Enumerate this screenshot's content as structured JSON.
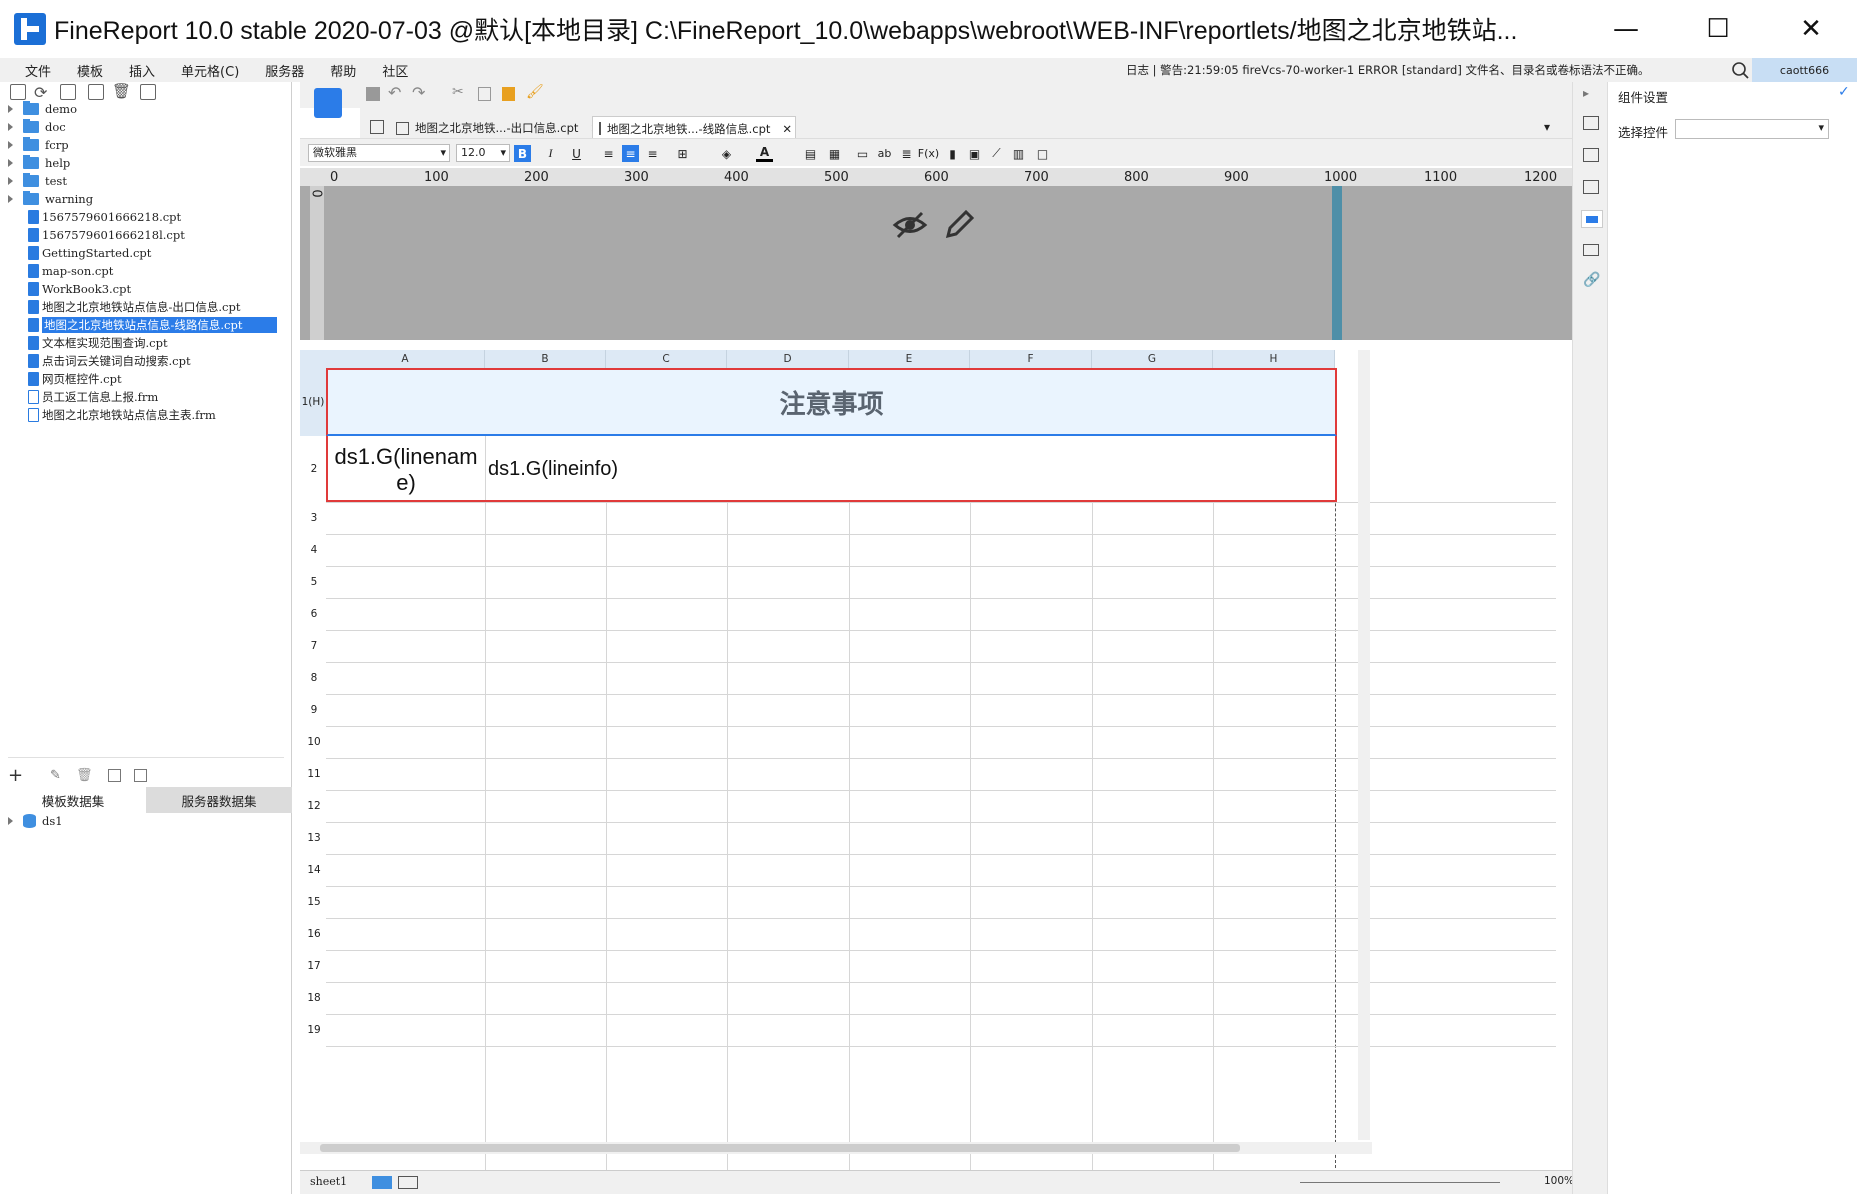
{
  "window": {
    "title": "FineReport 10.0 stable 2020-07-03 @默认[本地目录]    C:\\FineReport_10.0\\webapps\\webroot\\WEB-INF\\reportlets/地图之北京地铁站...",
    "minimize": "—",
    "maximize": "☐",
    "close": "✕"
  },
  "menubar": {
    "items": [
      "文件",
      "模板",
      "插入",
      "单元格(C)",
      "服务器",
      "帮助",
      "社区"
    ],
    "log": "日志 | 警告:21:59:05 fireVcs-70-worker-1 ERROR [standard] 文件名、目录名或卷标语法不正确。",
    "user": "caott666"
  },
  "file_tree": {
    "folders": [
      "demo",
      "doc",
      "fcrp",
      "help",
      "test",
      "warning"
    ],
    "files": [
      {
        "name": "1567579601666218.cpt",
        "type": "cpt"
      },
      {
        "name": "1567579601666218l.cpt",
        "type": "cpt"
      },
      {
        "name": "GettingStarted.cpt",
        "type": "cpt"
      },
      {
        "name": "map-son.cpt",
        "type": "cpt"
      },
      {
        "name": "WorkBook3.cpt",
        "type": "cpt"
      },
      {
        "name": "地图之北京地铁站点信息-出口信息.cpt",
        "type": "cpt"
      },
      {
        "name": "地图之北京地铁站点信息-线路信息.cpt",
        "type": "cpt",
        "selected": true
      },
      {
        "name": "文本框实现范围查询.cpt",
        "type": "cpt"
      },
      {
        "name": "点击词云关键词自动搜索.cpt",
        "type": "cpt"
      },
      {
        "name": "网页框控件.cpt",
        "type": "cpt"
      },
      {
        "name": "员工返工信息上报.frm",
        "type": "frm"
      },
      {
        "name": "地图之北京地铁站点信息主表.frm",
        "type": "frm"
      }
    ]
  },
  "datasets": {
    "tabs": [
      "模板数据集",
      "服务器数据集"
    ],
    "items": [
      "ds1"
    ]
  },
  "doc_tabs": [
    {
      "label": "地图之北京地铁...-出口信息.cpt",
      "active": false
    },
    {
      "label": "地图之北京地铁...-线路信息.cpt",
      "active": true
    }
  ],
  "format_bar": {
    "font": "微软雅黑",
    "size": "12.0"
  },
  "ruler": {
    "ticks": [
      "0",
      "100",
      "200",
      "300",
      "400",
      "500",
      "600",
      "700",
      "800",
      "900",
      "1000",
      "1100",
      "1200"
    ],
    "left_zero": "0"
  },
  "sheet": {
    "columns": [
      "A",
      "B",
      "C",
      "D",
      "E",
      "F",
      "G",
      "H"
    ],
    "rows": [
      "1(H)",
      "2",
      "3",
      "4",
      "5",
      "6",
      "7",
      "8",
      "9",
      "10",
      "11",
      "12",
      "13",
      "14",
      "15",
      "16",
      "17",
      "18",
      "19"
    ],
    "header_cell": "注意事项",
    "cell_a2": "ds1.G(linename)",
    "cell_b2": "ds1.G(lineinfo)"
  },
  "right_panel": {
    "title": "组件设置",
    "select_label": "选择控件",
    "select_value": ""
  },
  "status": {
    "sheet": "sheet1",
    "zoom": "100%"
  },
  "colors": {
    "accent": "#2b7ce8",
    "header_bg": "#eaf4fe",
    "border_red": "#e03a3a"
  }
}
